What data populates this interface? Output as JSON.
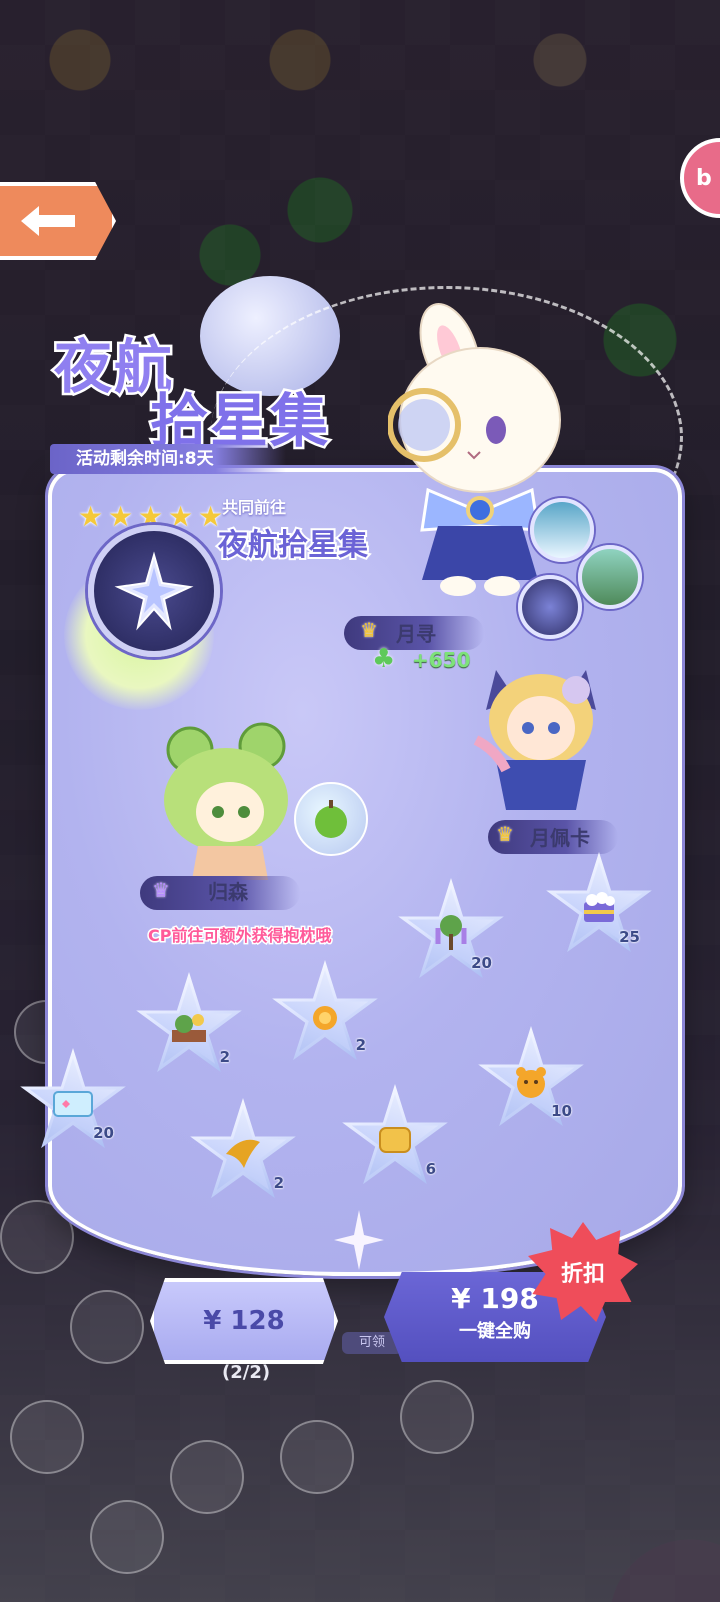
{
  "event": {
    "title_line1": "夜航",
    "title_line2": "拾星集",
    "timer": "活动剩余时间:8天",
    "subtitle_small": "共同前往",
    "subtitle_main": "夜航拾星集",
    "star_rating": 5
  },
  "characters": [
    {
      "name": "月寻",
      "bonus": "+650"
    },
    {
      "name": "月佩卡"
    },
    {
      "name": "归森",
      "note": "CP前往可额外获得抱枕哦"
    }
  ],
  "rewards": [
    {
      "qty": "20",
      "icon": "wisteria-tree-icon"
    },
    {
      "qty": "25",
      "icon": "cake-box-icon"
    },
    {
      "qty": "2",
      "icon": "tree-stall-icon"
    },
    {
      "qty": "2",
      "icon": "gold-ornament-icon"
    },
    {
      "qty": "10",
      "icon": "orange-bear-icon"
    },
    {
      "qty": "20",
      "icon": "ticket-card-icon"
    },
    {
      "qty": "2",
      "icon": "golden-bird-icon"
    },
    {
      "qty": "6",
      "icon": "bread-block-icon"
    }
  ],
  "purchase": {
    "price_single": "¥ 128",
    "progress": "(2/2)",
    "price_all": "¥ 198",
    "buy_all_label": "一键全购",
    "discount_label": "折扣",
    "small_tag": "可领"
  },
  "colors": {
    "panel": "#b2b3ef",
    "title": "#8f7ff0",
    "accent": "#6b63d6",
    "discount": "#ef4d5a"
  }
}
